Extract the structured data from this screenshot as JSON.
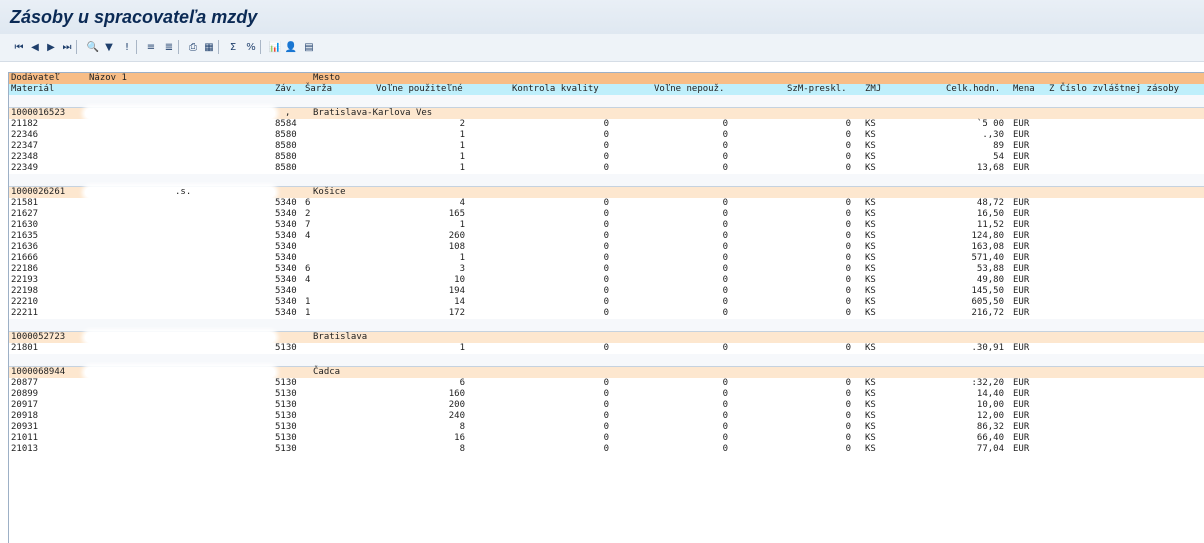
{
  "title": "Zásoby u spracovateľa mzdy",
  "toolbar": {
    "icons": [
      "first-page-icon",
      "previous-page-icon",
      "next-page-icon",
      "last-page-icon",
      "details-icon",
      "filter-icon",
      "info-icon",
      "sort-ascending-icon",
      "sort-filter-icon",
      "print-icon",
      "columns-icon",
      "sum-icon",
      "subtotal-icon",
      "export-icon",
      "layout-icon",
      "graph-icon"
    ],
    "glyphs": [
      "⏮",
      "◀",
      "▶",
      "⏭",
      "🔍",
      "▼",
      "!",
      "≡",
      "≣",
      "⎙",
      "▦",
      "Σ",
      "%",
      "📊",
      "👤",
      "▤"
    ]
  },
  "header1": {
    "vendor": "Dodávateľ",
    "name": "Názov 1",
    "city": "Mesto"
  },
  "header2": {
    "material": "Materiál",
    "plant": "Záv.",
    "batch": "Šarža",
    "unrestricted": "Voľne použiteľné",
    "quality": "Kontrola kvality",
    "blocked": "Voľne nepouž.",
    "transfer": "SzM-preskl.",
    "uom": "ZMJ",
    "value": "Celk.hodn.",
    "currency": "Mena",
    "special": "Z Číslo zvláštnej zásoby"
  },
  "groups": [
    {
      "vendor": "1000016523",
      "name": ",",
      "city": "Bratislava-Karlova Ves",
      "rows": [
        {
          "material": "21182",
          "plant": "8584",
          "batch": "",
          "unrestricted": "2",
          "quality": "0",
          "blocked": "0",
          "transfer": "0",
          "uom": "KS",
          "value": "`5 00",
          "currency": "EUR"
        },
        {
          "material": "22346",
          "plant": "8580",
          "batch": "",
          "unrestricted": "1",
          "quality": "0",
          "blocked": "0",
          "transfer": "0",
          "uom": "KS",
          "value": ".,30",
          "currency": "EUR"
        },
        {
          "material": "22347",
          "plant": "8580",
          "batch": "",
          "unrestricted": "1",
          "quality": "0",
          "blocked": "0",
          "transfer": "0",
          "uom": "KS",
          "value": "89",
          "currency": "EUR"
        },
        {
          "material": "22348",
          "plant": "8580",
          "batch": "",
          "unrestricted": "1",
          "quality": "0",
          "blocked": "0",
          "transfer": "0",
          "uom": "KS",
          "value": "54",
          "currency": "EUR"
        },
        {
          "material": "22349",
          "plant": "8580",
          "batch": "",
          "unrestricted": "1",
          "quality": "0",
          "blocked": "0",
          "transfer": "0",
          "uom": "KS",
          "value": "13,68",
          "currency": "EUR"
        }
      ]
    },
    {
      "vendor": "1000026261",
      "name": ".s.",
      "city": "Košice",
      "rows": [
        {
          "material": "21581",
          "plant": "5340",
          "batch": "6",
          "unrestricted": "4",
          "quality": "0",
          "blocked": "0",
          "transfer": "0",
          "uom": "KS",
          "value": "48,72",
          "currency": "EUR"
        },
        {
          "material": "21627",
          "plant": "5340",
          "batch": "2",
          "unrestricted": "165",
          "quality": "0",
          "blocked": "0",
          "transfer": "0",
          "uom": "KS",
          "value": "16,50",
          "currency": "EUR"
        },
        {
          "material": "21630",
          "plant": "5340",
          "batch": "7",
          "unrestricted": "1",
          "quality": "0",
          "blocked": "0",
          "transfer": "0",
          "uom": "KS",
          "value": "11,52",
          "currency": "EUR"
        },
        {
          "material": "21635",
          "plant": "5340",
          "batch": "4",
          "unrestricted": "260",
          "quality": "0",
          "blocked": "0",
          "transfer": "0",
          "uom": "KS",
          "value": "124,80",
          "currency": "EUR"
        },
        {
          "material": "21636",
          "plant": "5340",
          "batch": "",
          "unrestricted": "108",
          "quality": "0",
          "blocked": "0",
          "transfer": "0",
          "uom": "KS",
          "value": "163,08",
          "currency": "EUR"
        },
        {
          "material": "21666",
          "plant": "5340",
          "batch": "",
          "unrestricted": "1",
          "quality": "0",
          "blocked": "0",
          "transfer": "0",
          "uom": "KS",
          "value": "571,40",
          "currency": "EUR"
        },
        {
          "material": "22186",
          "plant": "5340",
          "batch": "6",
          "unrestricted": "3",
          "quality": "0",
          "blocked": "0",
          "transfer": "0",
          "uom": "KS",
          "value": "53,88",
          "currency": "EUR"
        },
        {
          "material": "22193",
          "plant": "5340",
          "batch": "4",
          "unrestricted": "10",
          "quality": "0",
          "blocked": "0",
          "transfer": "0",
          "uom": "KS",
          "value": "49,80",
          "currency": "EUR"
        },
        {
          "material": "22198",
          "plant": "5340",
          "batch": "",
          "unrestricted": "194",
          "quality": "0",
          "blocked": "0",
          "transfer": "0",
          "uom": "KS",
          "value": "145,50",
          "currency": "EUR"
        },
        {
          "material": "22210",
          "plant": "5340",
          "batch": "1",
          "unrestricted": "14",
          "quality": "0",
          "blocked": "0",
          "transfer": "0",
          "uom": "KS",
          "value": "605,50",
          "currency": "EUR"
        },
        {
          "material": "22211",
          "plant": "5340",
          "batch": "1",
          "unrestricted": "172",
          "quality": "0",
          "blocked": "0",
          "transfer": "0",
          "uom": "KS",
          "value": "216,72",
          "currency": "EUR"
        }
      ]
    },
    {
      "vendor": "1000052723",
      "name": "",
      "city": "Bratislava",
      "rows": [
        {
          "material": "21801",
          "plant": "5130",
          "batch": "",
          "unrestricted": "1",
          "quality": "0",
          "blocked": "0",
          "transfer": "0",
          "uom": "KS",
          "value": ".30,91",
          "currency": "EUR"
        }
      ]
    },
    {
      "vendor": "1000068944",
      "name": "",
      "city": "Čadca",
      "rows": [
        {
          "material": "20877",
          "plant": "5130",
          "batch": "",
          "unrestricted": "6",
          "quality": "0",
          "blocked": "0",
          "transfer": "0",
          "uom": "KS",
          "value": ":32,20",
          "currency": "EUR"
        },
        {
          "material": "20899",
          "plant": "5130",
          "batch": "",
          "unrestricted": "160",
          "quality": "0",
          "blocked": "0",
          "transfer": "0",
          "uom": "KS",
          "value": "14,40",
          "currency": "EUR"
        },
        {
          "material": "20917",
          "plant": "5130",
          "batch": "",
          "unrestricted": "200",
          "quality": "0",
          "blocked": "0",
          "transfer": "0",
          "uom": "KS",
          "value": "10,00",
          "currency": "EUR"
        },
        {
          "material": "20918",
          "plant": "5130",
          "batch": "",
          "unrestricted": "240",
          "quality": "0",
          "blocked": "0",
          "transfer": "0",
          "uom": "KS",
          "value": "12,00",
          "currency": "EUR"
        },
        {
          "material": "20931",
          "plant": "5130",
          "batch": "",
          "unrestricted": "8",
          "quality": "0",
          "blocked": "0",
          "transfer": "0",
          "uom": "KS",
          "value": "86,32",
          "currency": "EUR"
        },
        {
          "material": "21011",
          "plant": "5130",
          "batch": "",
          "unrestricted": "16",
          "quality": "0",
          "blocked": "0",
          "transfer": "0",
          "uom": "KS",
          "value": "66,40",
          "currency": "EUR"
        },
        {
          "material": "21013",
          "plant": "5130",
          "batch": "",
          "unrestricted": "8",
          "quality": "0",
          "blocked": "0",
          "transfer": "0",
          "uom": "KS",
          "value": "77,04",
          "currency": "EUR"
        }
      ]
    }
  ]
}
